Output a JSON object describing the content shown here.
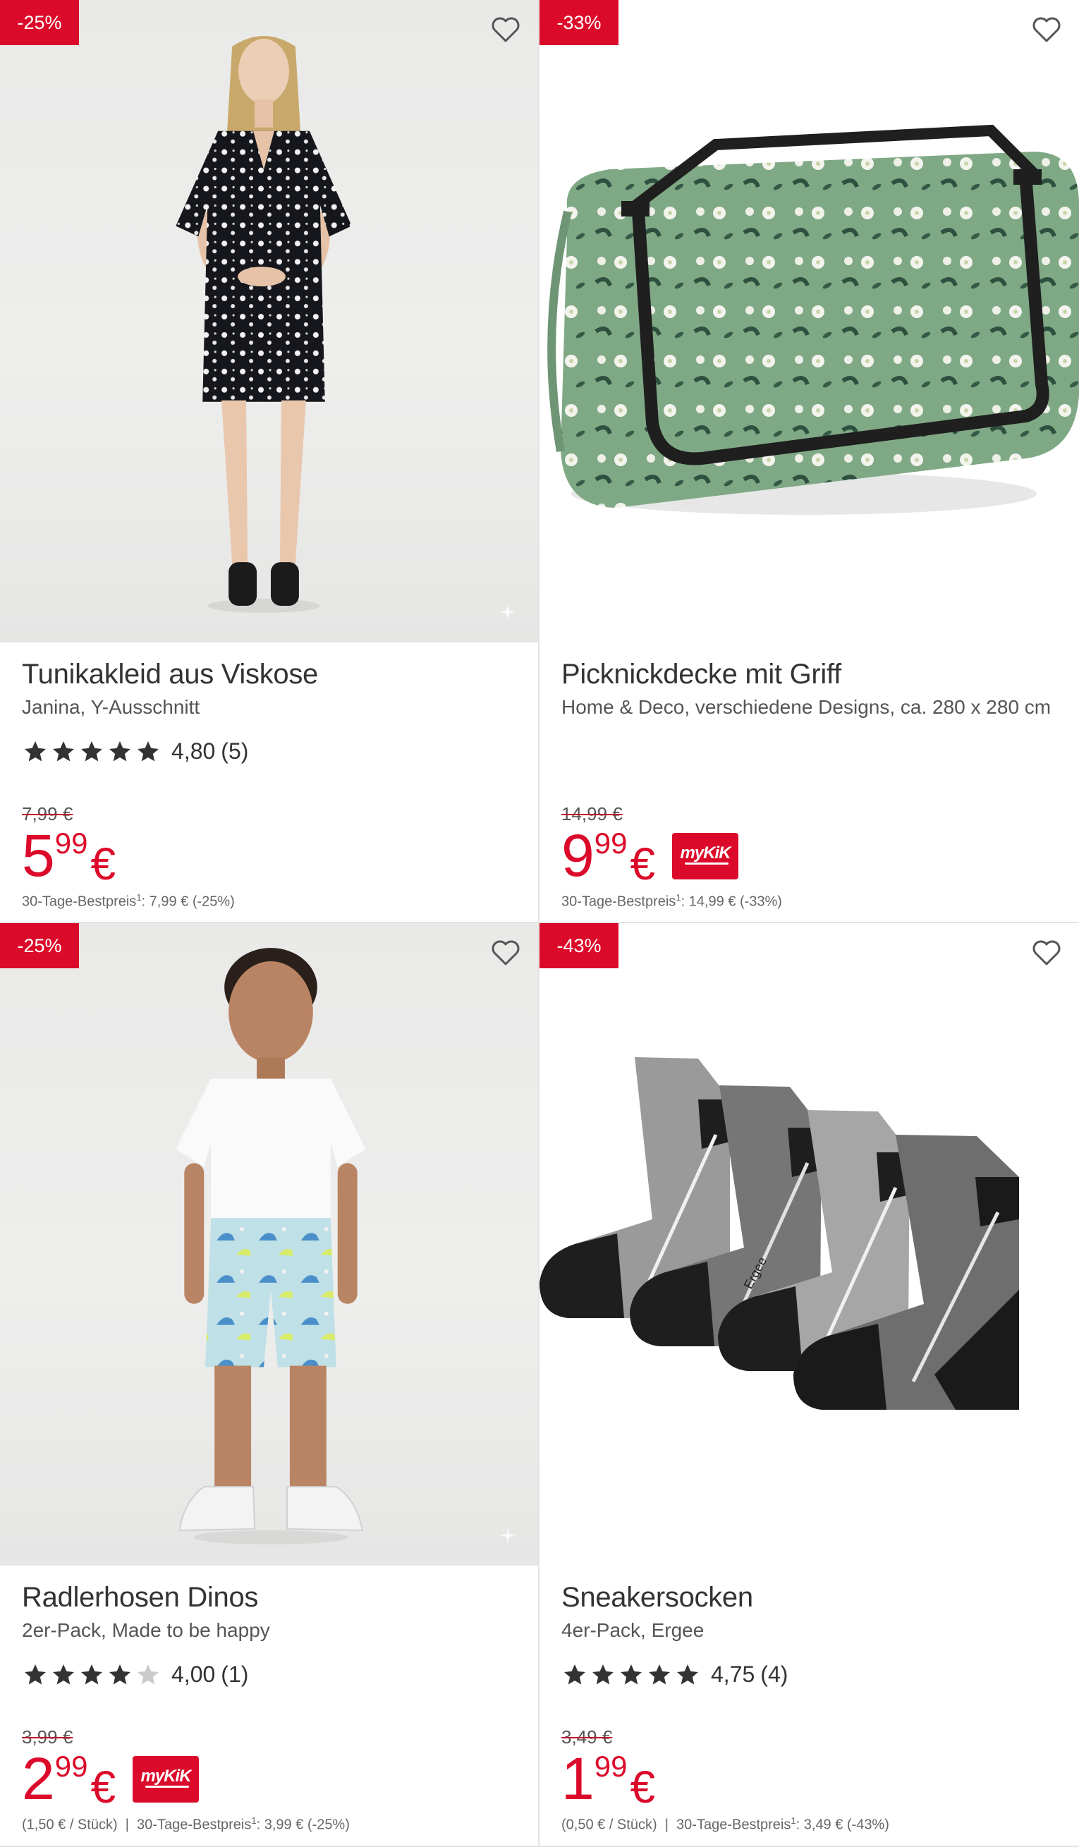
{
  "products": [
    {
      "badge": "-25%",
      "title": "Tunikakleid aus Viskose",
      "subtitle": "Janina, Y-Ausschnitt",
      "rating": {
        "stars": 5,
        "score": "4,80",
        "count": "(5)"
      },
      "old_price": "7,99 €",
      "price": {
        "int": "5",
        "dec": "99",
        "currency": "€"
      },
      "mykik": false,
      "footnote": {
        "per_unit": "",
        "label": "30-Tage-Bestpreis",
        "sup": "1",
        "value": ": 7,99 € (-25%)"
      },
      "favorite_icon": "heart-outline-icon",
      "image": "model-floral-dress"
    },
    {
      "badge": "-33%",
      "title": "Picknickdecke mit Griff",
      "subtitle": "Home & Deco, verschiedene Designs, ca. 280 x 280 cm",
      "rating": null,
      "old_price": "14,99 €",
      "price": {
        "int": "9",
        "dec": "99",
        "currency": "€"
      },
      "mykik": true,
      "mykik_label": "myKiK",
      "footnote": {
        "per_unit": "",
        "label": "30-Tage-Bestpreis",
        "sup": "1",
        "value": ": 14,99 € (-33%)"
      },
      "favorite_icon": "heart-outline-icon",
      "image": "rolled-green-picnic-blanket"
    },
    {
      "badge": "-25%",
      "title": "Radlerhosen Dinos",
      "subtitle": "2er-Pack, Made to be happy",
      "rating": {
        "stars": 4,
        "score": "4,00",
        "count": "(1)"
      },
      "old_price": "3,99 €",
      "price": {
        "int": "2",
        "dec": "99",
        "currency": "€"
      },
      "mykik": true,
      "mykik_label": "myKiK",
      "footnote": {
        "per_unit": "(1,50 € / Stück)",
        "label": "30-Tage-Bestpreis",
        "sup": "1",
        "value": ": 3,99 € (-25%)"
      },
      "favorite_icon": "heart-outline-icon",
      "image": "child-in-dino-shorts"
    },
    {
      "badge": "-43%",
      "title": "Sneakersocken",
      "subtitle": "4er-Pack, Ergee",
      "rating": {
        "stars": 5,
        "score": "4,75",
        "count": "(4)"
      },
      "old_price": "3,49 €",
      "price": {
        "int": "1",
        "dec": "99",
        "currency": "€"
      },
      "mykik": false,
      "footnote": {
        "per_unit": "(0,50 € / Stück)",
        "label": "30-Tage-Bestpreis",
        "sup": "1",
        "value": ": 3,49 € (-43%)"
      },
      "favorite_icon": "heart-outline-icon",
      "image": "four-gray-sneaker-socks"
    }
  ],
  "sock_brand": "Ergee",
  "colors": {
    "accent": "#dc0a2a",
    "text": "#333333",
    "muted": "#666666",
    "star": "#333333",
    "star_empty": "#cccccc"
  }
}
